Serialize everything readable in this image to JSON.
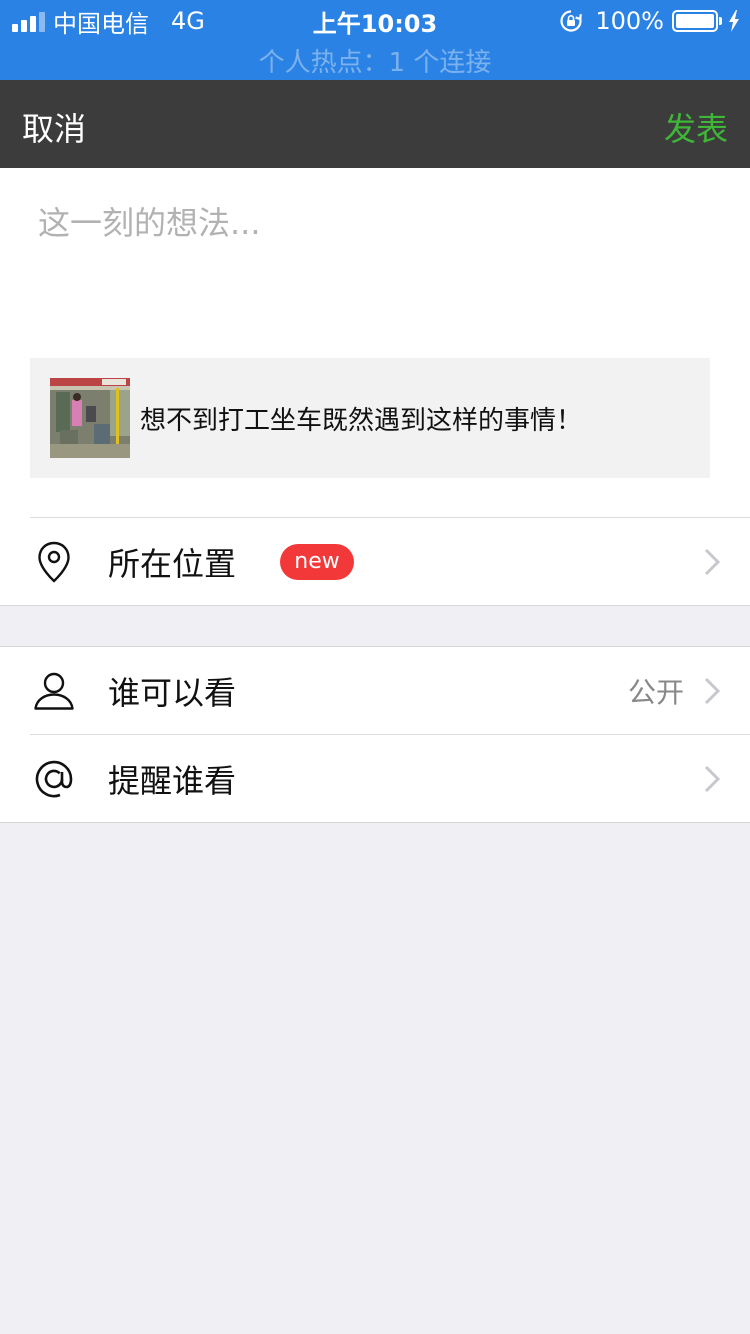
{
  "status_bar": {
    "carrier": "中国电信",
    "network": "4G",
    "time": "上午10:03",
    "battery": "100%",
    "battery_level": 1.0,
    "signal_bars": 3,
    "hotspot": "个人热点：1 个连接"
  },
  "nav": {
    "cancel": "取消",
    "post": "发表"
  },
  "composer": {
    "placeholder": "这一刻的想法...",
    "value": "",
    "shared_title": "想不到打工坐车既然遇到这样的事情！"
  },
  "location": {
    "label": "所在位置",
    "badge": "new"
  },
  "visibility": {
    "label": "谁可以看",
    "value": "公开"
  },
  "mention": {
    "label": "提醒谁看"
  },
  "colors": {
    "status_bar": "#2a82e4",
    "nav_bar": "#3c3c3c",
    "post_green": "#3fb638",
    "badge_red": "#f23838",
    "background": "#efeff4"
  }
}
